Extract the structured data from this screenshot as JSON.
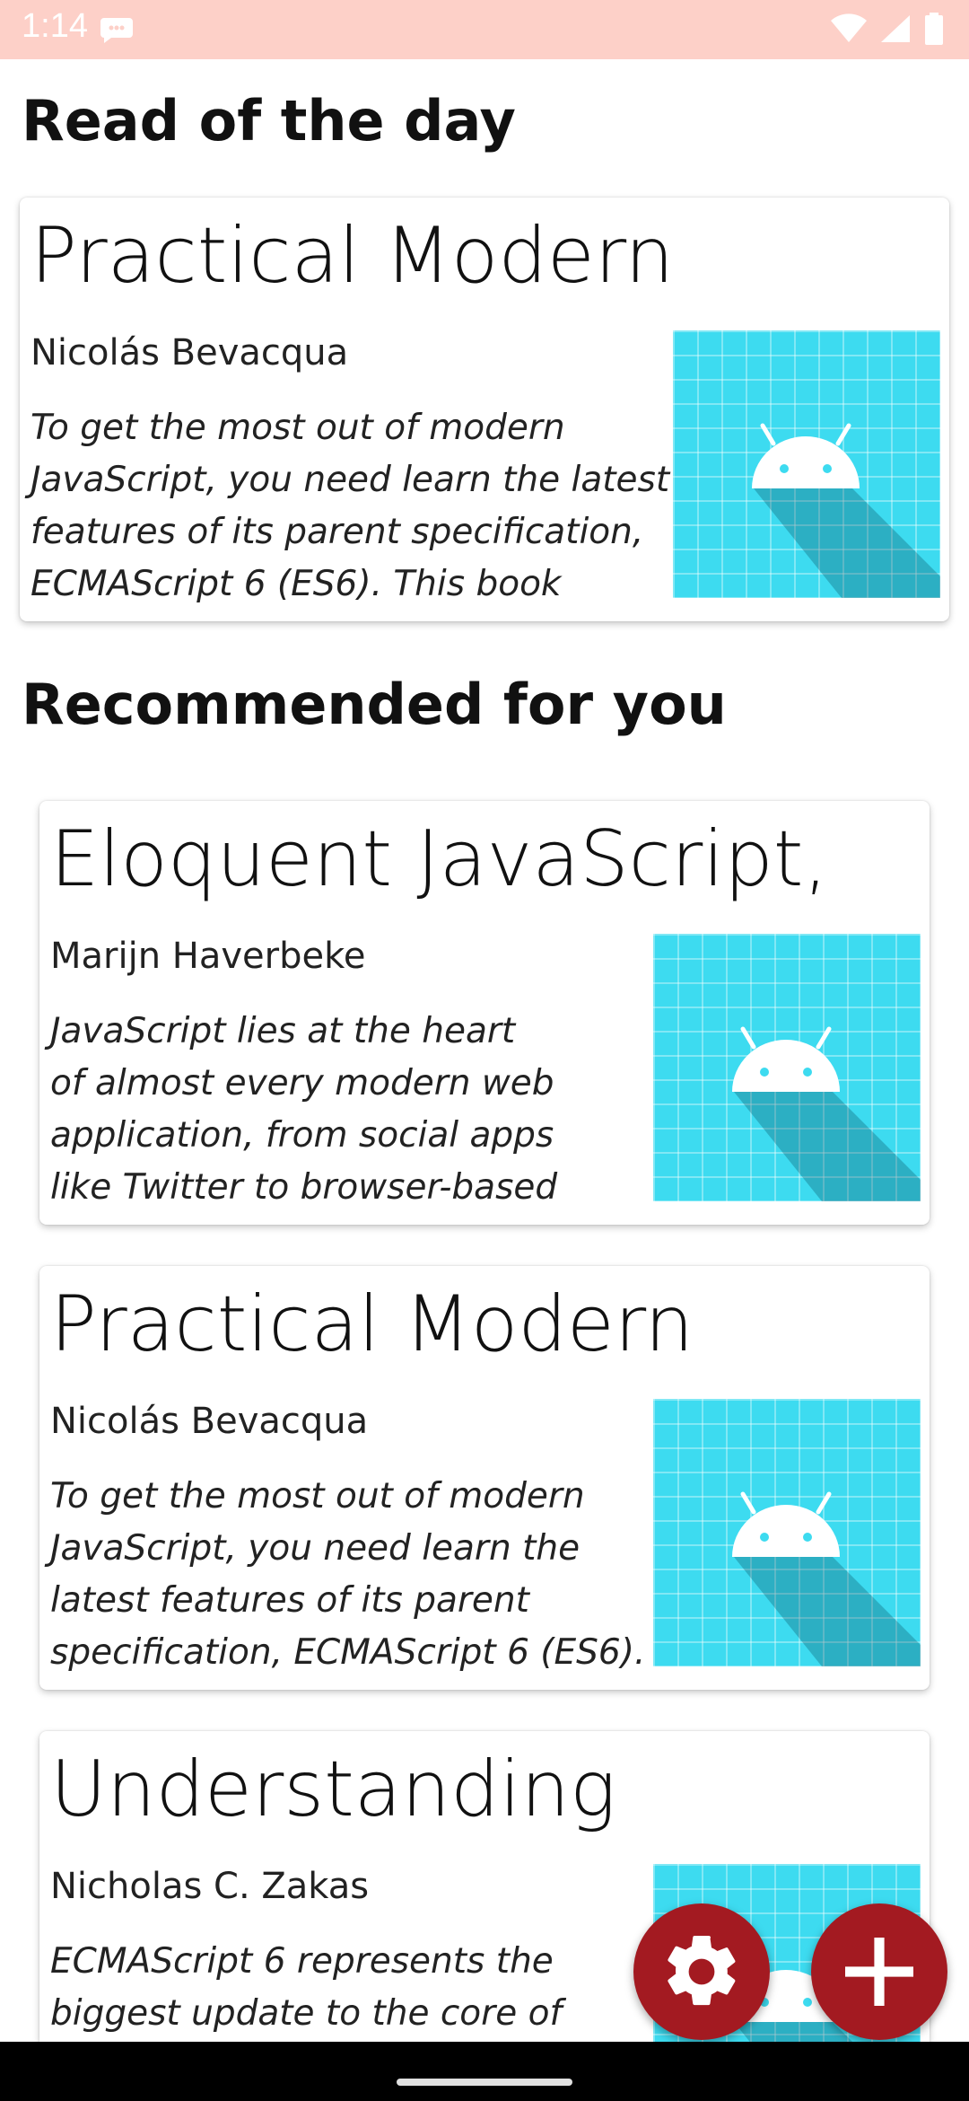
{
  "status_bar": {
    "time": "1:14",
    "icons": [
      "chat-icon",
      "wifi-icon",
      "signal-icon",
      "battery-icon"
    ]
  },
  "read_of_the_day": {
    "heading": "Read of the day",
    "book": {
      "title": "Practical Modern",
      "author": "Nicolás Bevacqua",
      "desc_lines": [
        "To get the most out of modern",
        "JavaScript, you need learn the latest",
        "features of its parent specification,",
        "ECMAScript 6 (ES6). This book"
      ]
    }
  },
  "recommended": {
    "heading": "Recommended for you",
    "books": [
      {
        "title": "Eloquent JavaScript,",
        "author": "Marijn Haverbeke",
        "desc_lines": [
          "JavaScript lies at the heart",
          "of almost every modern web",
          "application, from social apps",
          "like Twitter to browser-based"
        ]
      },
      {
        "title": "Practical Modern",
        "author": "Nicolás Bevacqua",
        "desc_lines": [
          "To get the most out of modern",
          "JavaScript, you need learn the",
          "latest features of its parent",
          "specification, ECMAScript 6 (ES6)."
        ]
      },
      {
        "title": "Understanding",
        "author": "Nicholas C. Zakas",
        "desc_lines": [
          "ECMAScript 6 represents the",
          "biggest update to the core of"
        ]
      }
    ]
  },
  "fabs": {
    "settings_icon": "gear-icon",
    "add_icon": "plus-icon"
  },
  "colors": {
    "status_bar": "#fdd0c8",
    "fab": "#a31a21",
    "thumbnail": "#3ddbf0"
  }
}
